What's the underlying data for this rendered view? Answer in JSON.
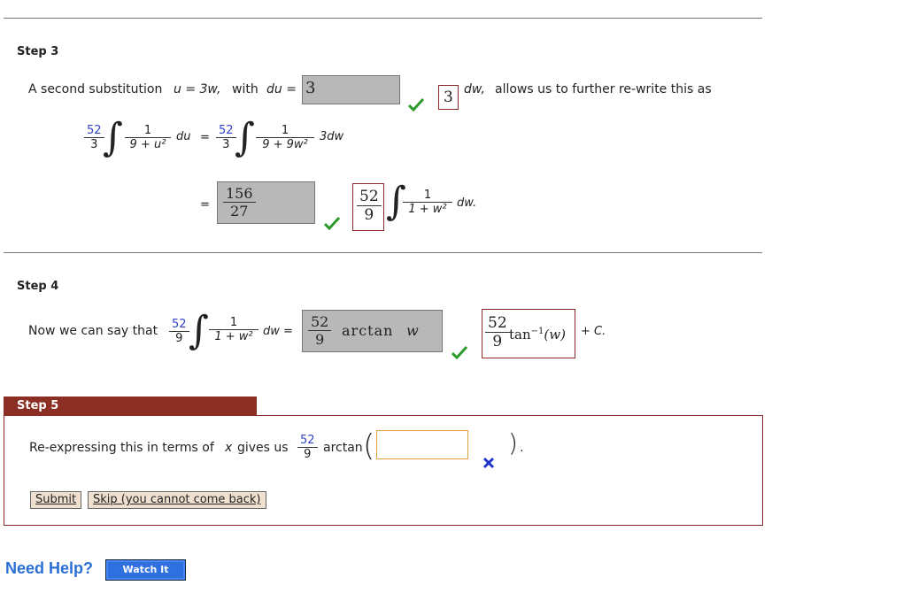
{
  "step3": {
    "title": "Step 3",
    "intro_a": "A second substitution",
    "u_eq": "u = 3w,",
    "with": "with",
    "du_eq": "du =",
    "du_answer": "3",
    "du_key": "3",
    "dw_tail": "dw,",
    "intro_b": "allows us to further re-write this as",
    "coef_num": "52",
    "coef_den": "3",
    "f1_num": "1",
    "f1_den": "9 + u²",
    "du": "du",
    "eq": "=",
    "coef2_num": "52",
    "coef2_den": "3",
    "f2_num": "1",
    "f2_den": "9 + 9w²",
    "three_dw": "3dw",
    "eq2": "=",
    "ans2_num": "156",
    "ans2_den": "27",
    "key2_num": "52",
    "key2_den": "9",
    "f3_num": "1",
    "f3_den": "1 + w²",
    "dw_end": "dw."
  },
  "step4": {
    "title": "Step 4",
    "intro": "Now we can say that",
    "coef_num": "52",
    "coef_den": "9",
    "f_num": "1",
    "f_den": "1 + w²",
    "dw_eq": "dw =",
    "ans_num": "52",
    "ans_den": "9",
    "ans_fn": "arctan",
    "ans_var": "w",
    "key_num": "52",
    "key_den": "9",
    "key_fn": "tan",
    "key_sup": "−1",
    "key_arg": "(w)",
    "plus_c": "+ C."
  },
  "step5": {
    "title": "Step 5",
    "intro": "Re-expressing this in terms of",
    "x": "x",
    "gives": "gives us",
    "coef_num": "52",
    "coef_den": "9",
    "fn": "arctan",
    "close": ").",
    "input_value": "",
    "submit_label": "Submit",
    "skip_label": "Skip (you cannot come back)"
  },
  "help": {
    "label": "Need Help?",
    "watch_label": "Watch It"
  },
  "colors": {
    "step_tab": "#8b2e24",
    "check": "#2a9a2a",
    "cross": "#2233cc",
    "help_blue": "#2a6fd6"
  },
  "icons": {
    "correct": "check-icon",
    "incorrect": "cross-icon"
  }
}
